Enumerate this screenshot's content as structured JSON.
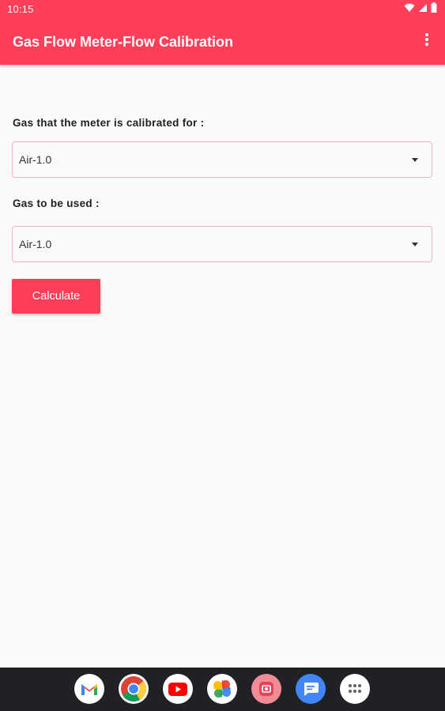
{
  "status_bar": {
    "time": "10:15",
    "icons": [
      "wifi-icon",
      "cellular-signal-icon",
      "battery-icon"
    ]
  },
  "app_bar": {
    "title": "Gas Flow Meter-Flow Calibration",
    "overflow_icon": "more-vert-icon",
    "color": "#ff3e59"
  },
  "form": {
    "calibrated_gas": {
      "label": "Gas that the meter is calibrated for :",
      "selected": "Air-1.0"
    },
    "used_gas": {
      "label": "Gas to be used :",
      "selected": "Air-1.0"
    },
    "calculate_label": "Calculate"
  },
  "dock": {
    "apps": [
      "gmail-icon",
      "chrome-icon",
      "youtube-icon",
      "google-photos-icon",
      "camera-app-icon",
      "messages-icon",
      "app-drawer-icon"
    ]
  }
}
